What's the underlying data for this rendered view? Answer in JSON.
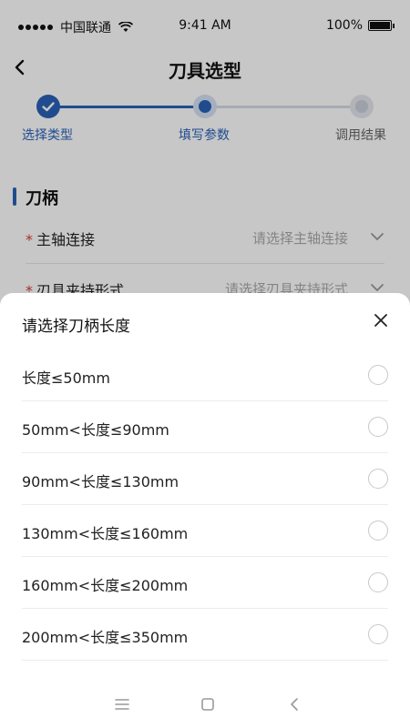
{
  "status_bar": {
    "carrier": "中国联通",
    "time": "9:41 AM",
    "battery": "100%"
  },
  "header": {
    "title": "刀具选型"
  },
  "stepper": {
    "steps": [
      {
        "label": "选择类型",
        "state": "done"
      },
      {
        "label": "填写参数",
        "state": "current"
      },
      {
        "label": "调用结果",
        "state": "pending"
      }
    ]
  },
  "form": {
    "section_title": "刀柄",
    "required_mark": "*",
    "fields": [
      {
        "label": "主轴连接",
        "placeholder": "请选择主轴连接"
      },
      {
        "label": "刃具夹持形式",
        "placeholder": "请选择刃具夹持形式"
      }
    ]
  },
  "sheet": {
    "title": "请选择刀柄长度",
    "options": [
      {
        "label": "长度≤50mm"
      },
      {
        "label": "50mm<长度≤90mm"
      },
      {
        "label": "90mm<长度≤130mm"
      },
      {
        "label": "130mm<长度≤160mm"
      },
      {
        "label": "160mm<长度≤200mm"
      },
      {
        "label": "200mm<长度≤350mm"
      }
    ]
  },
  "colors": {
    "accent": "#2a62b8",
    "required": "#d23c3c",
    "overlay": "rgba(0,0,0,0.22)"
  },
  "icons": [
    "back-icon",
    "checkmark-icon",
    "chevron-down-icon",
    "close-icon",
    "wifi-icon",
    "battery-icon",
    "menu-icon",
    "home-icon",
    "nav-back-icon"
  ]
}
